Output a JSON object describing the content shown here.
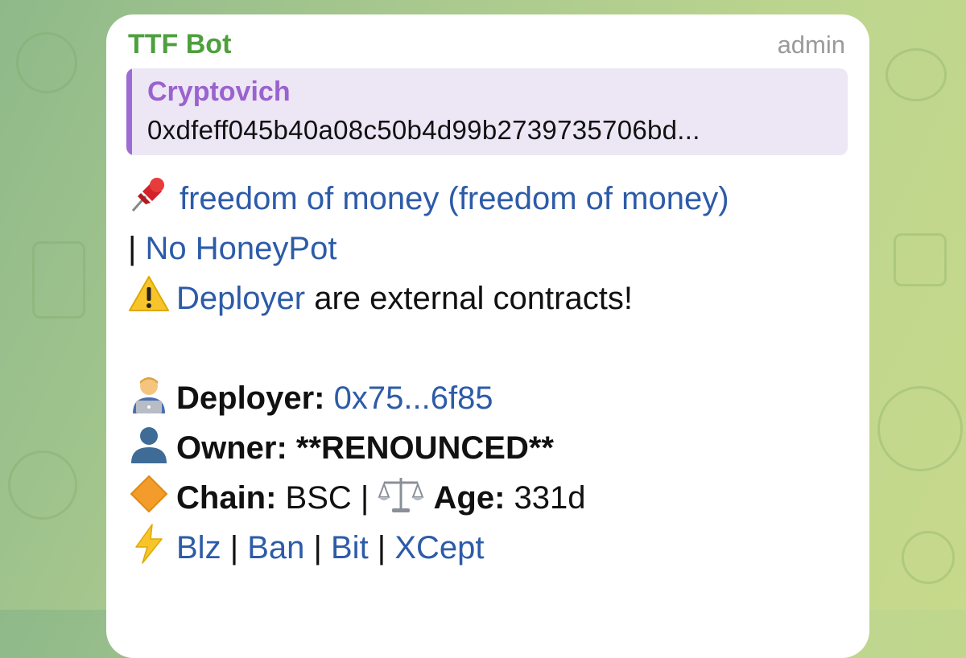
{
  "message": {
    "sender": "TTF Bot",
    "role": "admin",
    "reply": {
      "name": "Cryptovich",
      "text": "0xdfeff045b40a08c50b4d99b2739735706bd..."
    },
    "lines": {
      "token_link": "freedom of money (freedom of money)",
      "sep1": "| ",
      "honeypot_link": "No HoneyPot",
      "warning_link": "Deployer",
      "warning_text": " are external contracts!",
      "deployer_label": "Deployer:",
      "deployer_value": "0x75...6f85",
      "owner_label": "Owner:",
      "owner_value": " **RENOUNCED**",
      "chain_label": "Chain:",
      "chain_value": " BSC | ",
      "age_label": "Age:",
      "age_value": " 331d",
      "links": [
        "Blz",
        "Ban",
        "Bit",
        "XCept"
      ],
      "link_sep": " | "
    }
  },
  "icons": {
    "token": "pushpin-icon",
    "warning": "warning-icon",
    "deployer": "technologist-icon",
    "owner": "person-silhouette-icon",
    "chain": "orange-diamond-icon",
    "age": "balance-scale-icon",
    "links": "lightning-icon"
  },
  "colors": {
    "sender": "#4e9f3d",
    "reply_name": "#9a62cf",
    "reply_bg": "#ece6f5",
    "link": "#2d5ba8"
  }
}
